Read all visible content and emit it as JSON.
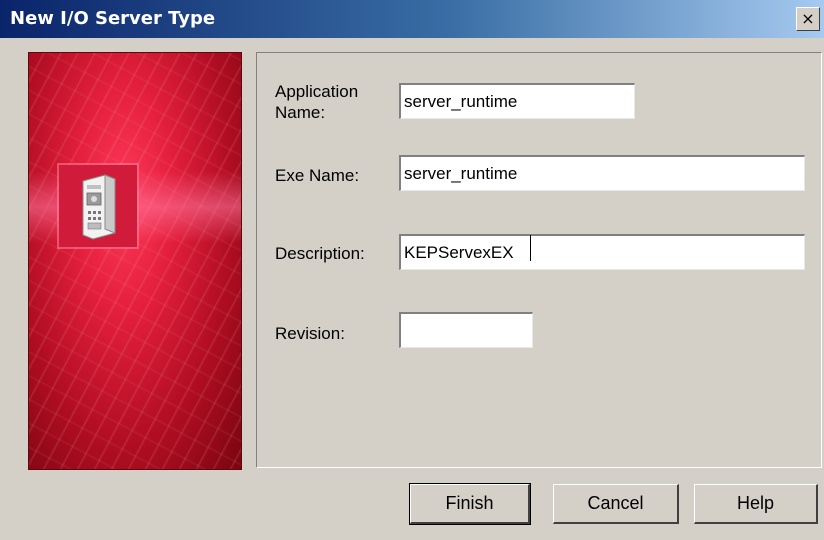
{
  "window": {
    "title": "New I/O Server Type",
    "close_glyph": "×"
  },
  "banner": {
    "icon": "server-computer-icon",
    "colors": {
      "primary": "#d91a35",
      "dark": "#7a0510"
    }
  },
  "form": {
    "application_name": {
      "label": "Application Name:",
      "value": "server_runtime"
    },
    "exe_name": {
      "label": "Exe Name:",
      "value": "server_runtime"
    },
    "description": {
      "label": "Description:",
      "value": "KEPServexEX"
    },
    "revision": {
      "label": "Revision:",
      "value": ""
    }
  },
  "buttons": {
    "finish": "Finish",
    "cancel": "Cancel",
    "help": "Help"
  }
}
